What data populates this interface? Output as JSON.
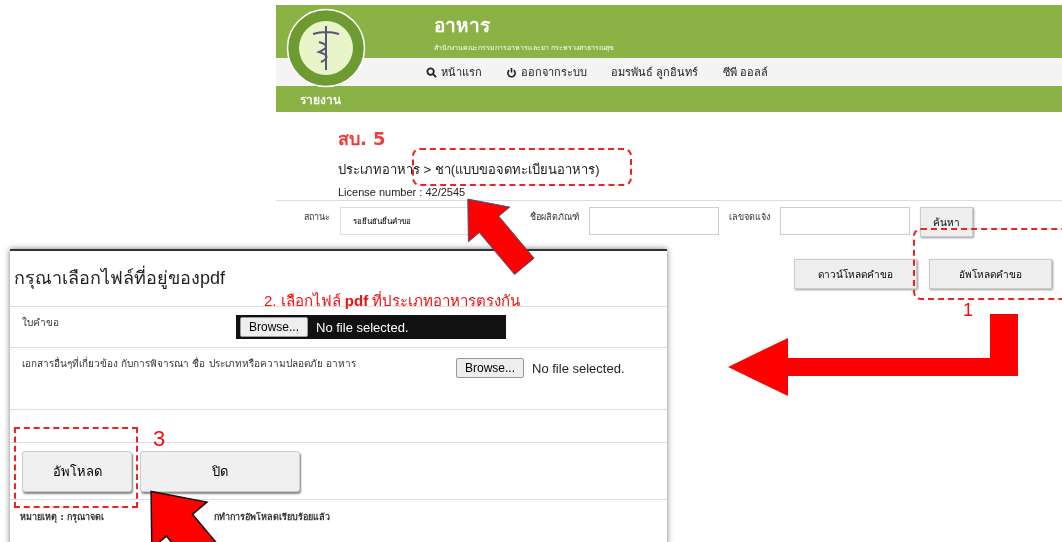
{
  "site": {
    "title": "อาหาร",
    "subtitle": "สำนักงานคณะกรรมการอาหารและยา กระทรวงสาธารณสุข",
    "nav": [
      {
        "label": "หน้าแรก"
      },
      {
        "label": "ออกจากระบบ"
      },
      {
        "label": "อมรพันธ์ ลูกอินทร์"
      },
      {
        "label": "ซีพี ออลล์"
      }
    ],
    "section": "รายงาน"
  },
  "page": {
    "heading": "สบ. 5",
    "breadcrumb": "ประเภทอาหาร > ชา(แบบขอจดทะเบียนอาหาร)",
    "license": "License number : 42/2545",
    "filters": [
      {
        "label": "สถานะ",
        "kind": "select",
        "value": "รอยืนยันยื่นคำขอ"
      },
      {
        "label": "ชื่อผลิตภัณฑ์",
        "kind": "input"
      },
      {
        "label": "เลขจดแจ้ง",
        "kind": "input"
      }
    ],
    "search_button": "ค้นหา",
    "actions": [
      "ดาวน์โหลดคำขอ",
      "อัพโหลดคำขอ"
    ]
  },
  "dialog": {
    "title": "กรุณาเลือกไฟล์ที่อยู่ของpdf",
    "files": [
      {
        "label": "ใบคำขอ",
        "button": "Browse...",
        "status": "No file selected.",
        "highlighted": true
      },
      {
        "label": "เอกสารอื่นๆที่เกี่ยวข้อง กับการพิจารณา ชื่อ ประเภทหรือความปลอดภัย อาหาร",
        "button": "Browse...",
        "status": "No file selected.",
        "highlighted": false
      }
    ],
    "buttons": [
      "อัพโหลด",
      "ปิด"
    ],
    "note_parts": [
      "หมายเหตุ : กรุณาจดเ",
      "กทำการอัพโหลดเรียบร้อยแล้ว"
    ]
  },
  "annotations": [
    {
      "kind": "step",
      "text": "1"
    },
    {
      "kind": "instruction",
      "text": "2. เลือกไฟล์ **pdf** ที่ประเภทอาหารตรงกัน"
    },
    {
      "kind": "step",
      "text": "3"
    }
  ]
}
